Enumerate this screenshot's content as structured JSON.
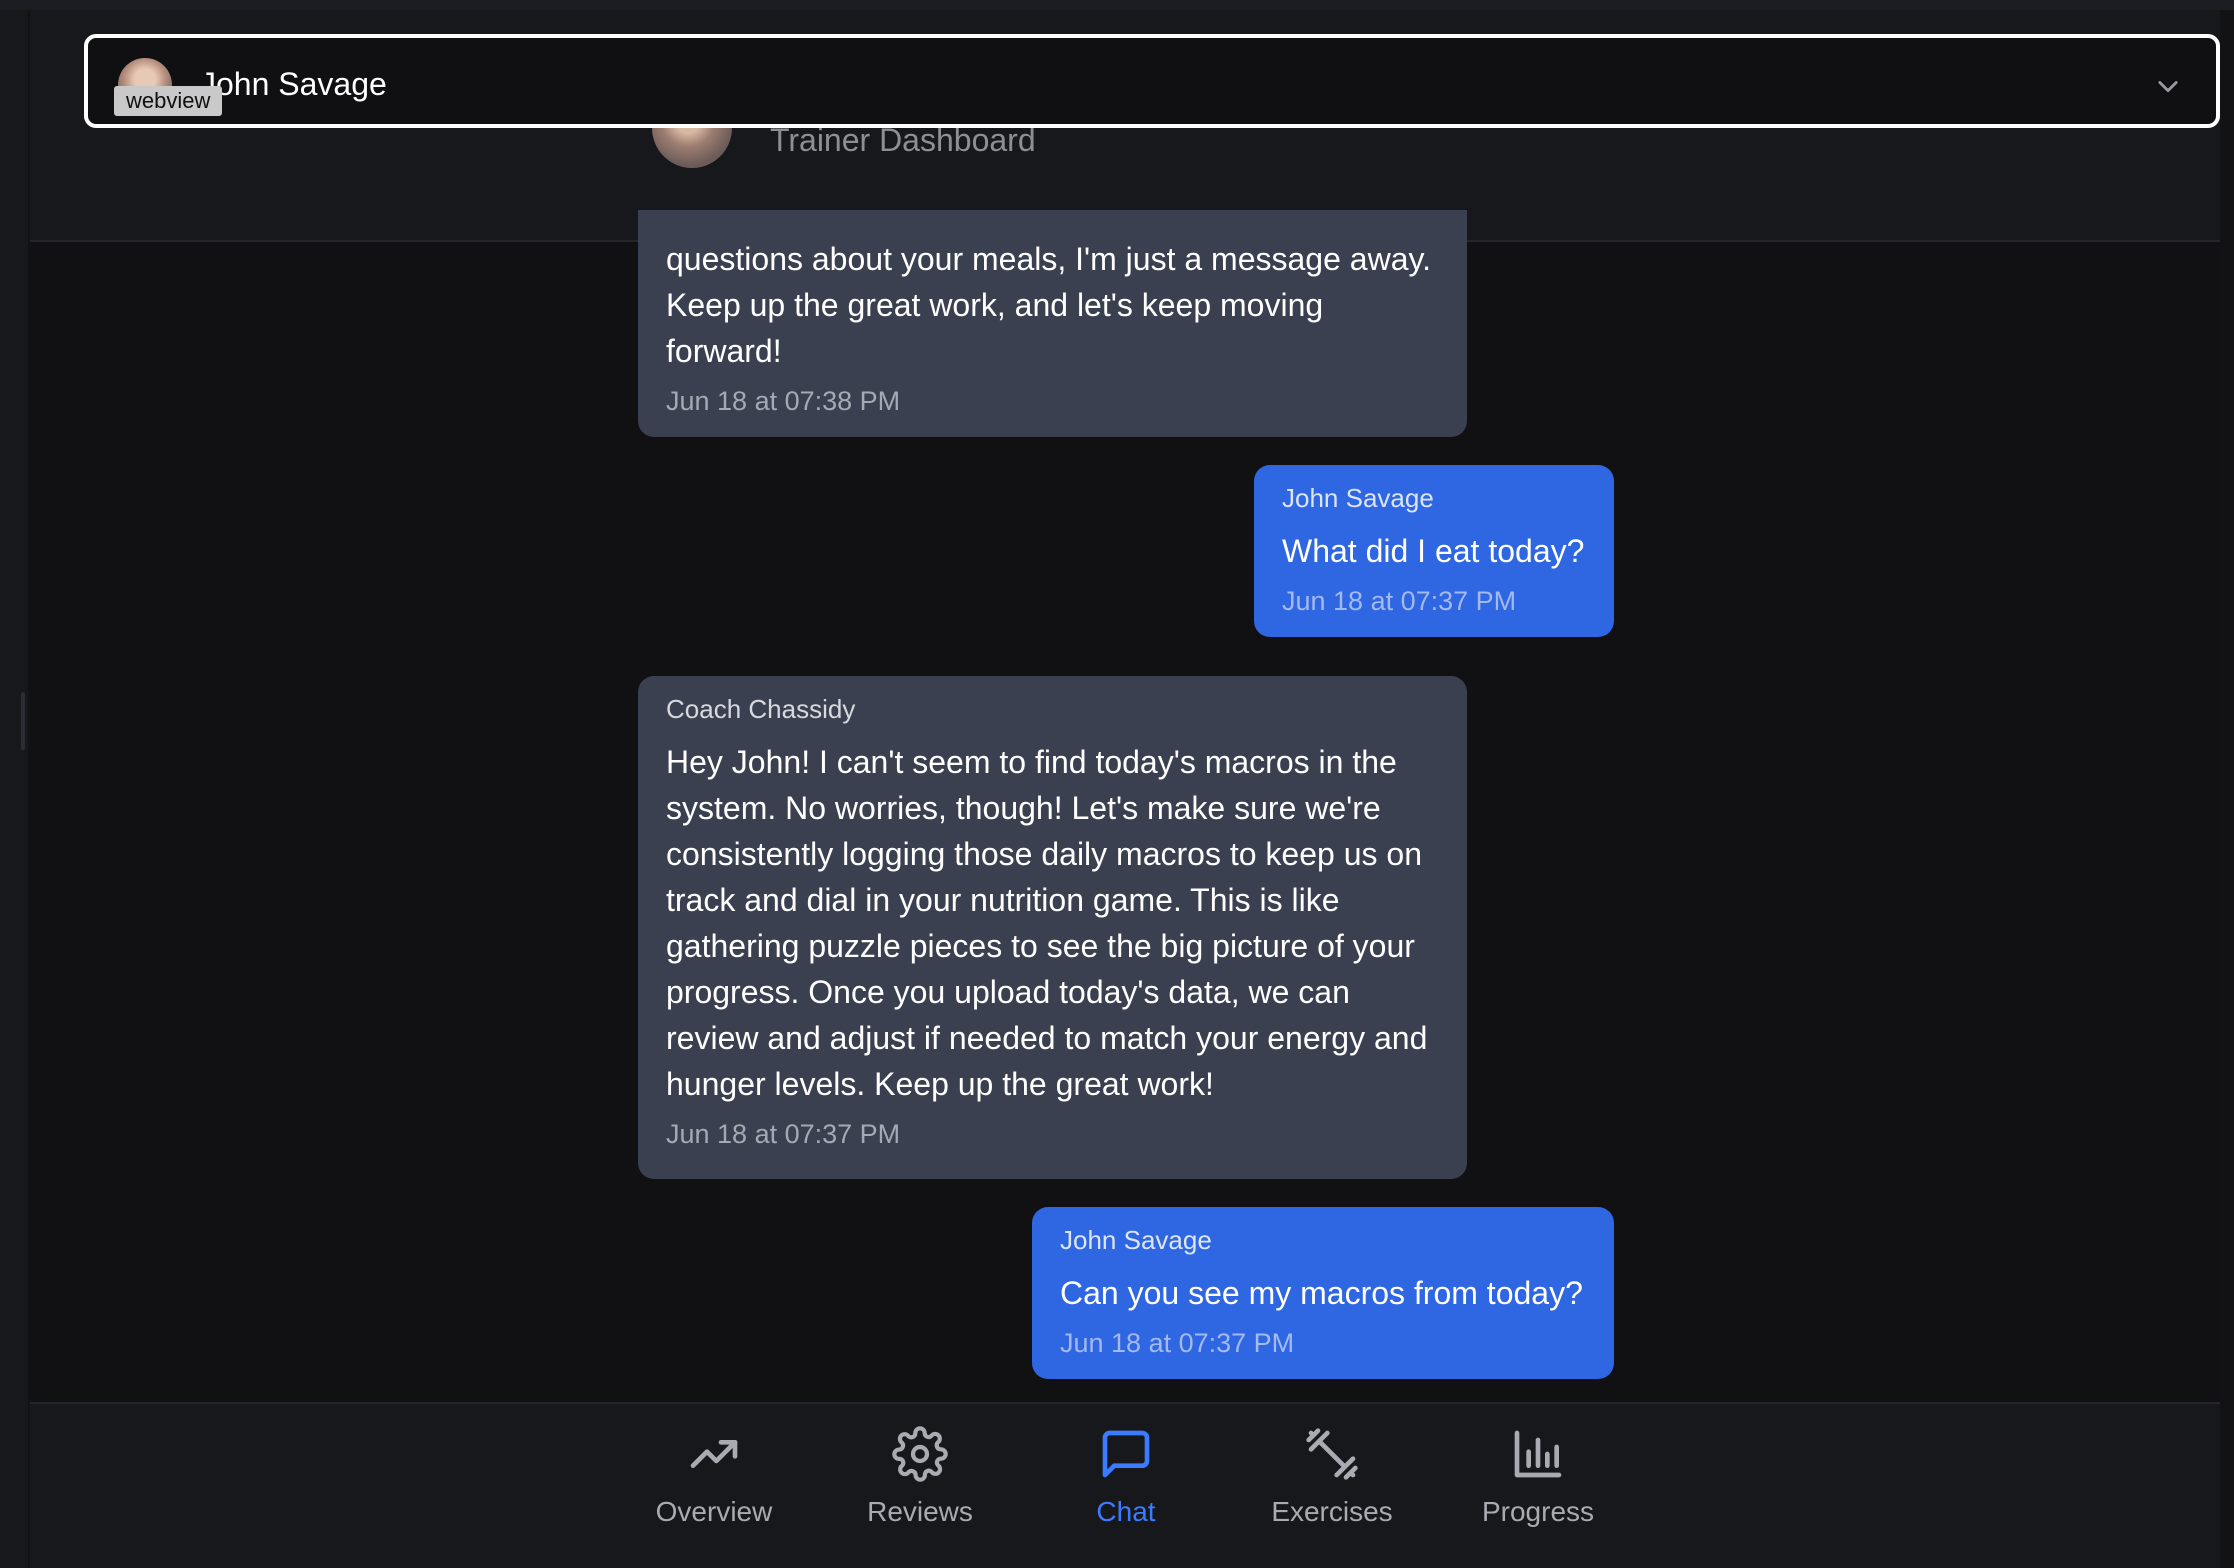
{
  "selector": {
    "name": "John Savage",
    "badge": "webview"
  },
  "header": {
    "title": "Trainer Dashboard"
  },
  "messages": [
    {
      "type": "coach",
      "sender": "",
      "text": "questions about your meals, I'm just a message away. Keep up the great work, and let's keep moving forward!",
      "time": "Jun 18 at 07:38 PM"
    },
    {
      "type": "me",
      "sender": "John Savage",
      "text": "What did I eat today?",
      "time": "Jun 18 at 07:37 PM"
    },
    {
      "type": "coach",
      "sender": "Coach Chassidy",
      "text": "Hey John! I can't seem to find today's macros in the system. No worries, though! Let's make sure we're consistently logging those daily macros to keep us on track and dial in your nutrition game. This is like gathering puzzle pieces to see the big picture of your progress. Once you upload today's data, we can review and adjust if needed to match your energy and hunger levels. Keep up the great work!",
      "time": "Jun 18 at 07:37 PM"
    },
    {
      "type": "me",
      "sender": "John Savage",
      "text": "Can you see my macros from today?",
      "time": "Jun 18 at 07:37 PM"
    }
  ],
  "nav": {
    "items": [
      {
        "label": "Overview",
        "icon": "trending-up-icon"
      },
      {
        "label": "Reviews",
        "icon": "gear-icon"
      },
      {
        "label": "Chat",
        "icon": "chat-bubble-icon",
        "active": true
      },
      {
        "label": "Exercises",
        "icon": "dumbbell-icon"
      },
      {
        "label": "Progress",
        "icon": "bar-chart-icon"
      }
    ]
  },
  "colors": {
    "background": "#111113",
    "coach_bubble": "#3b4050",
    "user_bubble": "#2f66e1",
    "active_nav": "#3b7bff"
  }
}
